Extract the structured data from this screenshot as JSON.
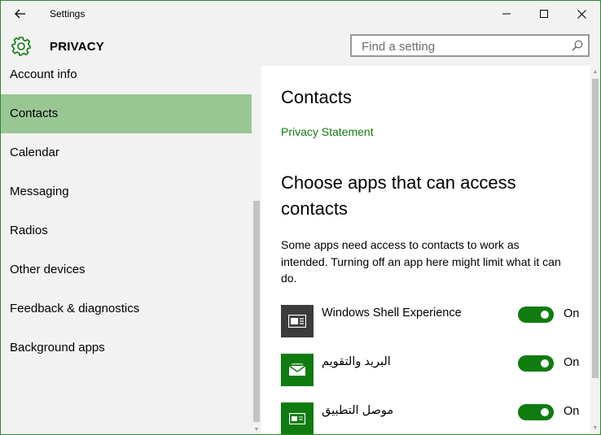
{
  "window": {
    "title": "Settings"
  },
  "header": {
    "title": "PRIVACY"
  },
  "search": {
    "placeholder": "Find a setting",
    "value": ""
  },
  "sidebar": {
    "items": [
      {
        "label": "Account info",
        "selected": false
      },
      {
        "label": "Contacts",
        "selected": true
      },
      {
        "label": "Calendar",
        "selected": false
      },
      {
        "label": "Messaging",
        "selected": false
      },
      {
        "label": "Radios",
        "selected": false
      },
      {
        "label": "Other devices",
        "selected": false
      },
      {
        "label": "Feedback & diagnostics",
        "selected": false
      },
      {
        "label": "Background apps",
        "selected": false
      }
    ]
  },
  "content": {
    "title": "Contacts",
    "privacy_link": "Privacy Statement",
    "section_title": "Choose apps that can access contacts",
    "description": "Some apps need access to contacts to work as intended. Turning off an app here might limit what it can do.",
    "apps": [
      {
        "name": "Windows Shell Experience",
        "state": "On",
        "on": true,
        "icon": "shell-experience-icon",
        "icon_bg": "#3c3c3c"
      },
      {
        "name": "البريد والتقويم",
        "state": "On",
        "on": true,
        "icon": "mail-calendar-icon",
        "icon_bg": "#107c10"
      },
      {
        "name": "موصل التطبيق",
        "state": "On",
        "on": true,
        "icon": "app-connector-icon",
        "icon_bg": "#107c10"
      }
    ]
  },
  "colors": {
    "accent": "#107c10",
    "selected_nav": "#99c794",
    "chrome_bg": "#f2f2f2",
    "window_border": "#2d8a2d"
  }
}
